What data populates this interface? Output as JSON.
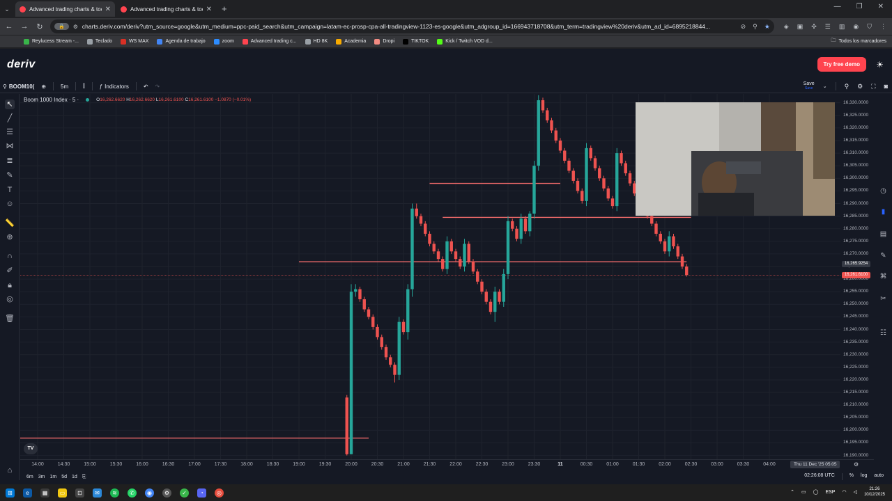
{
  "browser": {
    "tabs": [
      {
        "label": "Advanced trading charts & too",
        "active": true
      },
      {
        "label": "Advanced trading charts & too",
        "active": false
      }
    ],
    "omnibox_chip": "🔒",
    "url": "charts.deriv.com/deriv?utm_source=google&utm_medium=ppc-paid_search&utm_campaign=latam-ec-prosp-cpa-all-tradingview-1123-es-google&utm_adgroup_id=166943718708&utm_term=tradingview%20deriv&utm_ad_id=6895218844...",
    "bookmarks": [
      {
        "label": "Reylucess Stream -...",
        "color": "#39b54a"
      },
      {
        "label": "Teclado",
        "color": "#9aa0a6"
      },
      {
        "label": "WS MAX",
        "color": "#d93025"
      },
      {
        "label": "Agenda de trabajo",
        "color": "#4285f4"
      },
      {
        "label": "zoom",
        "color": "#2d8cff"
      },
      {
        "label": "Advanced trading c...",
        "color": "#ff444f"
      },
      {
        "label": "HD 8K",
        "color": "#9aa0a6"
      },
      {
        "label": "Academia",
        "color": "#f9ab00"
      },
      {
        "label": "Dropi",
        "color": "#f28b82"
      },
      {
        "label": "TIKTOK",
        "color": "#000000"
      },
      {
        "label": "Kick / Twitch VOD d...",
        "color": "#53fc18"
      }
    ],
    "bookmarks_all": "Todos los marcadores"
  },
  "header": {
    "logo": "deriv",
    "try_demo": "Try free demo"
  },
  "toolbar": {
    "symbol": "BOOM10(",
    "interval": "5m",
    "indicators": "Indicators",
    "save": "Save",
    "save_sub": "Save"
  },
  "legend": {
    "symbol_title": "Boom 1000 Index · 5 ·",
    "o_label": "O",
    "o_value": "16,262.6620",
    "h_label": "H",
    "h_value": "16,262.6620",
    "l_label": "L",
    "l_value": "16,261.6100",
    "c_label": "C",
    "c_value": "16,261.6100",
    "change": "−1.0870 (−0.01%)"
  },
  "chart_data": {
    "type": "candlestick",
    "title": "Boom 1000 Index · 5 ·",
    "x_ticks": [
      "14:00",
      "14:30",
      "15:00",
      "15:30",
      "16:00",
      "16:30",
      "17:00",
      "17:30",
      "18:00",
      "18:30",
      "19:00",
      "19:30",
      "20:00",
      "20:30",
      "21:00",
      "21:30",
      "22:00",
      "22:30",
      "23:00",
      "23:30",
      "11",
      "00:30",
      "01:00",
      "01:30",
      "02:00",
      "02:30",
      "03:00",
      "03:30",
      "04:00"
    ],
    "y_ticks": [
      "16,330.0000",
      "16,325.0000",
      "16,320.0000",
      "16,315.0000",
      "16,310.0000",
      "16,305.0000",
      "16,300.0000",
      "16,295.0000",
      "16,290.0000",
      "16,285.0000",
      "16,280.0000",
      "16,275.0000",
      "16,270.0000",
      "16,265.0000",
      "16,260.0000",
      "16,255.0000",
      "16,250.0000",
      "16,245.0000",
      "16,240.0000",
      "16,235.0000",
      "16,230.0000",
      "16,225.0000",
      "16,220.0000",
      "16,215.0000",
      "16,210.0000",
      "16,205.0000",
      "16,200.0000",
      "16,195.0000",
      "16,190.0000"
    ],
    "ylim": [
      16188.5,
      16333.5
    ],
    "current_price": "16,261.6100",
    "crosshair_price": "16,265.9254",
    "crosshair_date": "Thu 11 Dec '25   05:05",
    "horizontal_lines": [
      {
        "price": 16298.0,
        "from": "21:30",
        "to": "00:00"
      },
      {
        "price": 16284.5,
        "from": "21:45",
        "to": "02:30"
      },
      {
        "price": 16266.9,
        "from": "19:00",
        "to": "02:25"
      },
      {
        "price": 16196.9,
        "from": "13:30",
        "to": "20:20"
      }
    ],
    "candles": [
      {
        "t": "19:55",
        "o": 16213.0,
        "h": 16214.0,
        "l": 16190.0,
        "c": 16190.5
      },
      {
        "t": "20:00",
        "o": 16190.5,
        "h": 16258.0,
        "l": 16190.5,
        "c": 16255.0
      },
      {
        "t": "20:05",
        "o": 16255.0,
        "h": 16258.0,
        "l": 16253.0,
        "c": 16256.0
      },
      {
        "t": "20:10",
        "o": 16256.0,
        "h": 16257.0,
        "l": 16251.0,
        "c": 16252.0
      },
      {
        "t": "20:15",
        "o": 16252.0,
        "h": 16253.0,
        "l": 16247.0,
        "c": 16248.0
      },
      {
        "t": "20:20",
        "o": 16248.0,
        "h": 16249.0,
        "l": 16244.0,
        "c": 16245.0
      },
      {
        "t": "20:25",
        "o": 16245.0,
        "h": 16246.0,
        "l": 16240.0,
        "c": 16241.0
      },
      {
        "t": "20:30",
        "o": 16241.0,
        "h": 16242.0,
        "l": 16236.0,
        "c": 16237.0
      },
      {
        "t": "20:35",
        "o": 16237.0,
        "h": 16238.0,
        "l": 16232.0,
        "c": 16233.0
      },
      {
        "t": "20:40",
        "o": 16233.0,
        "h": 16234.0,
        "l": 16228.0,
        "c": 16229.0
      },
      {
        "t": "20:45",
        "o": 16229.0,
        "h": 16230.0,
        "l": 16225.0,
        "c": 16226.0
      },
      {
        "t": "20:50",
        "o": 16226.0,
        "h": 16227.0,
        "l": 16219.0,
        "c": 16222.0
      },
      {
        "t": "20:55",
        "o": 16222.0,
        "h": 16245.0,
        "l": 16220.0,
        "c": 16243.0
      },
      {
        "t": "21:00",
        "o": 16243.0,
        "h": 16244.0,
        "l": 16238.0,
        "c": 16239.0
      },
      {
        "t": "21:05",
        "o": 16239.0,
        "h": 16258.0,
        "l": 16236.0,
        "c": 16256.0
      },
      {
        "t": "21:10",
        "o": 16256.0,
        "h": 16290.0,
        "l": 16253.0,
        "c": 16288.0
      },
      {
        "t": "21:15",
        "o": 16288.0,
        "h": 16290.0,
        "l": 16284.0,
        "c": 16285.0
      },
      {
        "t": "21:20",
        "o": 16285.0,
        "h": 16286.0,
        "l": 16281.0,
        "c": 16282.0
      },
      {
        "t": "21:25",
        "o": 16282.0,
        "h": 16283.0,
        "l": 16277.0,
        "c": 16278.0
      },
      {
        "t": "21:30",
        "o": 16278.0,
        "h": 16279.0,
        "l": 16273.0,
        "c": 16274.0
      },
      {
        "t": "21:35",
        "o": 16274.0,
        "h": 16275.0,
        "l": 16270.0,
        "c": 16271.0
      },
      {
        "t": "21:40",
        "o": 16271.0,
        "h": 16272.0,
        "l": 16267.0,
        "c": 16268.0
      },
      {
        "t": "21:45",
        "o": 16268.0,
        "h": 16269.0,
        "l": 16263.0,
        "c": 16264.0
      },
      {
        "t": "21:50",
        "o": 16264.0,
        "h": 16277.0,
        "l": 16262.0,
        "c": 16275.0
      },
      {
        "t": "21:55",
        "o": 16275.0,
        "h": 16276.0,
        "l": 16270.0,
        "c": 16271.0
      },
      {
        "t": "22:00",
        "o": 16271.0,
        "h": 16272.0,
        "l": 16267.0,
        "c": 16268.0
      },
      {
        "t": "22:05",
        "o": 16268.0,
        "h": 16269.0,
        "l": 16264.0,
        "c": 16265.0
      },
      {
        "t": "22:10",
        "o": 16265.0,
        "h": 16276.0,
        "l": 16263.0,
        "c": 16274.0
      },
      {
        "t": "22:15",
        "o": 16274.0,
        "h": 16275.0,
        "l": 16266.0,
        "c": 16267.0
      },
      {
        "t": "22:20",
        "o": 16267.0,
        "h": 16268.0,
        "l": 16262.0,
        "c": 16263.0
      },
      {
        "t": "22:25",
        "o": 16263.0,
        "h": 16264.0,
        "l": 16258.0,
        "c": 16259.0
      },
      {
        "t": "22:30",
        "o": 16259.0,
        "h": 16260.0,
        "l": 16254.0,
        "c": 16255.0
      },
      {
        "t": "22:35",
        "o": 16255.0,
        "h": 16256.0,
        "l": 16250.0,
        "c": 16251.0
      },
      {
        "t": "22:40",
        "o": 16251.0,
        "h": 16252.0,
        "l": 16246.0,
        "c": 16247.0
      },
      {
        "t": "22:45",
        "o": 16247.0,
        "h": 16257.0,
        "l": 16243.0,
        "c": 16255.0
      },
      {
        "t": "22:50",
        "o": 16255.0,
        "h": 16256.0,
        "l": 16250.0,
        "c": 16251.0
      },
      {
        "t": "22:55",
        "o": 16251.0,
        "h": 16264.0,
        "l": 16249.0,
        "c": 16262.0
      },
      {
        "t": "23:00",
        "o": 16262.0,
        "h": 16285.0,
        "l": 16260.0,
        "c": 16283.0
      },
      {
        "t": "23:05",
        "o": 16283.0,
        "h": 16284.0,
        "l": 16279.0,
        "c": 16280.0
      },
      {
        "t": "23:10",
        "o": 16280.0,
        "h": 16281.0,
        "l": 16275.0,
        "c": 16276.0
      },
      {
        "t": "23:15",
        "o": 16276.0,
        "h": 16286.0,
        "l": 16274.0,
        "c": 16284.0
      },
      {
        "t": "23:20",
        "o": 16284.0,
        "h": 16285.0,
        "l": 16278.0,
        "c": 16279.0
      },
      {
        "t": "23:25",
        "o": 16279.0,
        "h": 16287.0,
        "l": 16277.0,
        "c": 16286.0
      },
      {
        "t": "23:30",
        "o": 16286.0,
        "h": 16307.0,
        "l": 16284.0,
        "c": 16305.0
      },
      {
        "t": "23:35",
        "o": 16305.0,
        "h": 16333.0,
        "l": 16303.0,
        "c": 16331.0
      },
      {
        "t": "23:40",
        "o": 16331.0,
        "h": 16332.0,
        "l": 16326.0,
        "c": 16327.0
      },
      {
        "t": "23:45",
        "o": 16327.0,
        "h": 16328.0,
        "l": 16322.0,
        "c": 16323.0
      },
      {
        "t": "23:50",
        "o": 16323.0,
        "h": 16324.0,
        "l": 16318.0,
        "c": 16319.0
      },
      {
        "t": "23:55",
        "o": 16319.0,
        "h": 16320.0,
        "l": 16314.0,
        "c": 16315.0
      },
      {
        "t": "00:00",
        "o": 16315.0,
        "h": 16316.0,
        "l": 16310.0,
        "c": 16311.0
      },
      {
        "t": "00:05",
        "o": 16311.0,
        "h": 16312.0,
        "l": 16306.0,
        "c": 16307.0
      },
      {
        "t": "00:10",
        "o": 16307.0,
        "h": 16308.0,
        "l": 16302.0,
        "c": 16303.0
      },
      {
        "t": "00:15",
        "o": 16303.0,
        "h": 16304.0,
        "l": 16298.0,
        "c": 16299.0
      },
      {
        "t": "00:20",
        "o": 16299.0,
        "h": 16300.0,
        "l": 16294.0,
        "c": 16295.0
      },
      {
        "t": "00:25",
        "o": 16295.0,
        "h": 16296.0,
        "l": 16290.0,
        "c": 16291.0
      },
      {
        "t": "00:30",
        "o": 16291.0,
        "h": 16314.0,
        "l": 16289.0,
        "c": 16312.0
      },
      {
        "t": "00:35",
        "o": 16312.0,
        "h": 16313.0,
        "l": 16307.0,
        "c": 16308.0
      },
      {
        "t": "00:40",
        "o": 16308.0,
        "h": 16309.0,
        "l": 16303.0,
        "c": 16304.0
      },
      {
        "t": "00:45",
        "o": 16304.0,
        "h": 16305.0,
        "l": 16299.0,
        "c": 16300.0
      },
      {
        "t": "00:50",
        "o": 16300.0,
        "h": 16301.0,
        "l": 16295.0,
        "c": 16296.0
      },
      {
        "t": "00:55",
        "o": 16296.0,
        "h": 16297.0,
        "l": 16291.0,
        "c": 16292.0
      },
      {
        "t": "01:00",
        "o": 16292.0,
        "h": 16293.0,
        "l": 16288.0,
        "c": 16289.0
      },
      {
        "t": "01:05",
        "o": 16289.0,
        "h": 16312.0,
        "l": 16287.0,
        "c": 16310.0
      },
      {
        "t": "01:10",
        "o": 16310.0,
        "h": 16311.0,
        "l": 16305.0,
        "c": 16306.0
      },
      {
        "t": "01:15",
        "o": 16306.0,
        "h": 16307.0,
        "l": 16301.0,
        "c": 16302.0
      },
      {
        "t": "01:20",
        "o": 16302.0,
        "h": 16303.0,
        "l": 16297.0,
        "c": 16298.0
      },
      {
        "t": "01:25",
        "o": 16298.0,
        "h": 16299.0,
        "l": 16293.0,
        "c": 16294.0
      },
      {
        "t": "01:30",
        "o": 16294.0,
        "h": 16295.0,
        "l": 16290.0,
        "c": 16291.0
      },
      {
        "t": "01:35",
        "o": 16291.0,
        "h": 16292.0,
        "l": 16287.0,
        "c": 16288.0
      },
      {
        "t": "01:40",
        "o": 16288.0,
        "h": 16289.0,
        "l": 16284.0,
        "c": 16285.0
      },
      {
        "t": "01:45",
        "o": 16285.0,
        "h": 16286.0,
        "l": 16281.0,
        "c": 16282.0
      },
      {
        "t": "01:50",
        "o": 16282.0,
        "h": 16283.0,
        "l": 16277.0,
        "c": 16278.0
      },
      {
        "t": "01:55",
        "o": 16278.0,
        "h": 16279.0,
        "l": 16274.0,
        "c": 16275.0
      },
      {
        "t": "02:00",
        "o": 16275.0,
        "h": 16276.0,
        "l": 16270.0,
        "c": 16271.0
      },
      {
        "t": "02:05",
        "o": 16271.0,
        "h": 16279.0,
        "l": 16269.0,
        "c": 16277.0
      },
      {
        "t": "02:10",
        "o": 16277.0,
        "h": 16278.0,
        "l": 16272.0,
        "c": 16273.0
      },
      {
        "t": "02:15",
        "o": 16273.0,
        "h": 16274.0,
        "l": 16268.0,
        "c": 16269.0
      },
      {
        "t": "02:20",
        "o": 16269.0,
        "h": 16270.0,
        "l": 16264.0,
        "c": 16265.0
      },
      {
        "t": "02:25",
        "o": 16265.0,
        "h": 16266.0,
        "l": 16261.0,
        "c": 16261.61
      }
    ],
    "colors": {
      "up": "#26a69a",
      "down": "#ef5350",
      "hline": "#f06a6a"
    }
  },
  "time_axis": {
    "bottom_ranges": [
      "6m",
      "3m",
      "1m",
      "5d",
      "1d"
    ],
    "clock": "02:26:08 UTC",
    "percent": "%",
    "log": "log",
    "auto": "auto"
  },
  "tv_badge": "TV",
  "taskbar": {
    "lang": "ESP",
    "time": "21:26",
    "date": "10/12/2025"
  }
}
